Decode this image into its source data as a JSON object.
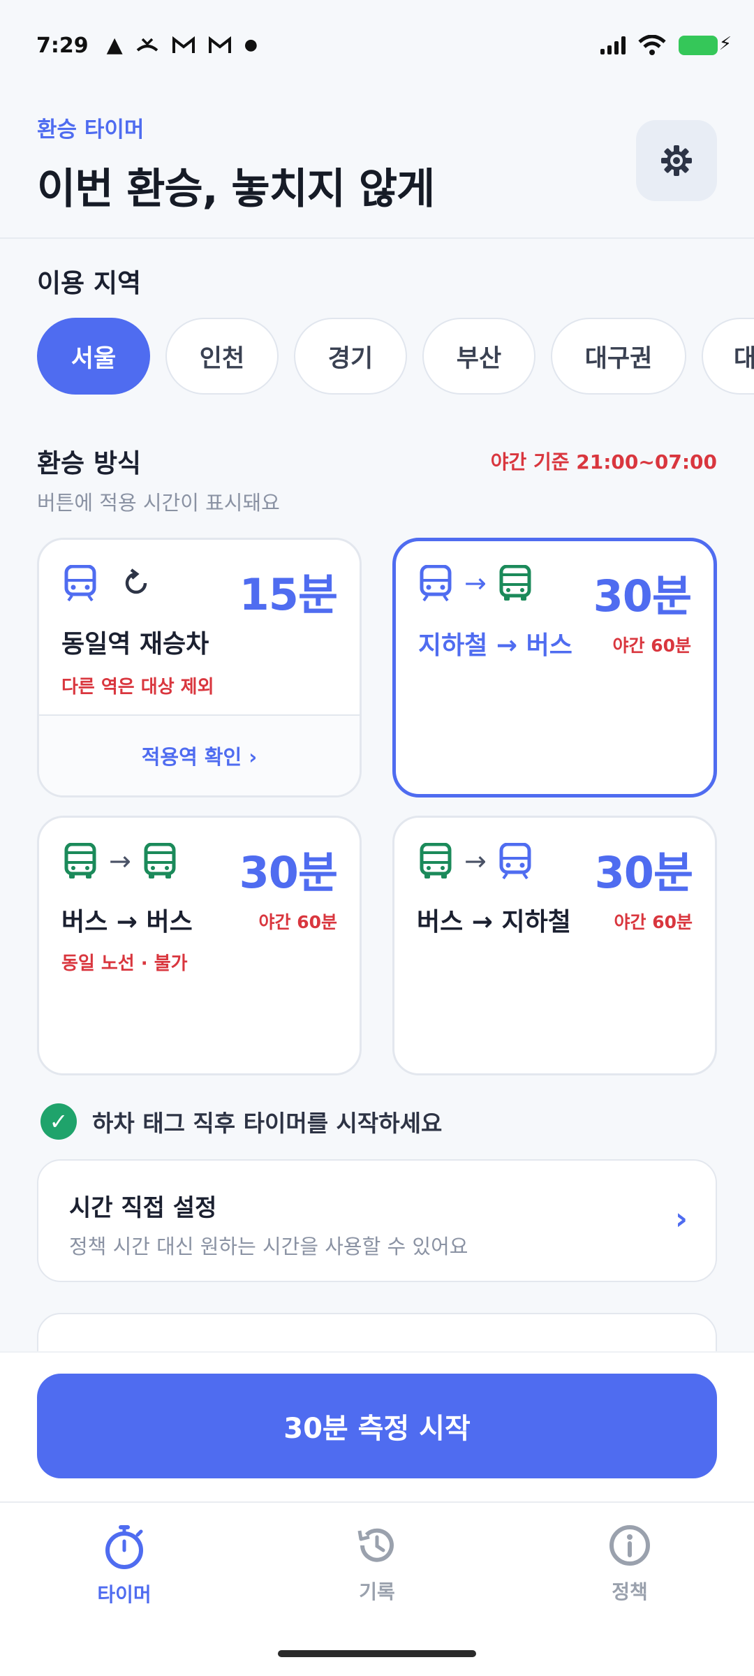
{
  "status_bar": {
    "time": "7:29",
    "left_icons": [
      "warning-icon",
      "missed-call-icon",
      "gmail-icon",
      "gmail-icon",
      "dot-icon"
    ],
    "right_icons": [
      "signal-icon",
      "wifi-icon",
      "battery-charging-icon"
    ]
  },
  "header": {
    "kicker": "환승 타이머",
    "title": "이번 환승, 놓치지 않게",
    "settings_icon": "gear-icon"
  },
  "region": {
    "label": "이용 지역",
    "chips": [
      {
        "label": "서울",
        "active": true
      },
      {
        "label": "인천",
        "active": false
      },
      {
        "label": "경기",
        "active": false
      },
      {
        "label": "부산",
        "active": false
      },
      {
        "label": "대구권",
        "active": false
      },
      {
        "label": "대",
        "active": false
      }
    ]
  },
  "transfer": {
    "label": "환승 방식",
    "night_note": "야간 기준 21:00~07:00",
    "subcaption": "버튼에 적용 시간이 표시돼요",
    "cards": [
      {
        "minutes": "15분",
        "title": "동일역 재승차",
        "note": "다른 역은 대상 제외",
        "footer": "적용역 확인 ›",
        "icons": [
          "subway-icon",
          "reload-icon"
        ],
        "selected": false
      },
      {
        "minutes": "30분",
        "title": "지하철 → 버스",
        "night": "야간 60분",
        "icons": [
          "subway-icon",
          "arrow-right-icon",
          "bus-icon"
        ],
        "selected": true
      },
      {
        "minutes": "30분",
        "title": "버스 → 버스",
        "night": "야간 60분",
        "note": "동일 노선 · 불가",
        "icons": [
          "bus-icon",
          "arrow-right-icon",
          "bus-icon"
        ],
        "selected": false
      },
      {
        "minutes": "30분",
        "title": "버스 → 지하철",
        "night": "야간 60분",
        "icons": [
          "bus-icon",
          "arrow-right-icon",
          "subway-icon"
        ],
        "selected": false
      }
    ]
  },
  "tip": {
    "text": "하차 태그 직후 타이머를 시작하세요",
    "icon": "check-circle-icon"
  },
  "manual": {
    "title": "시간 직접 설정",
    "description": "정책 시간 대신 원하는 시간을 사용할 수 있어요",
    "chevron": "›"
  },
  "start_button": {
    "label": "30분 측정 시작"
  },
  "tabs": [
    {
      "label": "타이머",
      "icon": "stopwatch-icon",
      "active": true
    },
    {
      "label": "기록",
      "icon": "history-icon",
      "active": false
    },
    {
      "label": "정책",
      "icon": "info-icon",
      "active": false
    }
  ],
  "colors": {
    "accent": "#4f6cf0",
    "alert": "#d9363e",
    "bus": "#1b8a5a",
    "success": "#1fa36b"
  }
}
